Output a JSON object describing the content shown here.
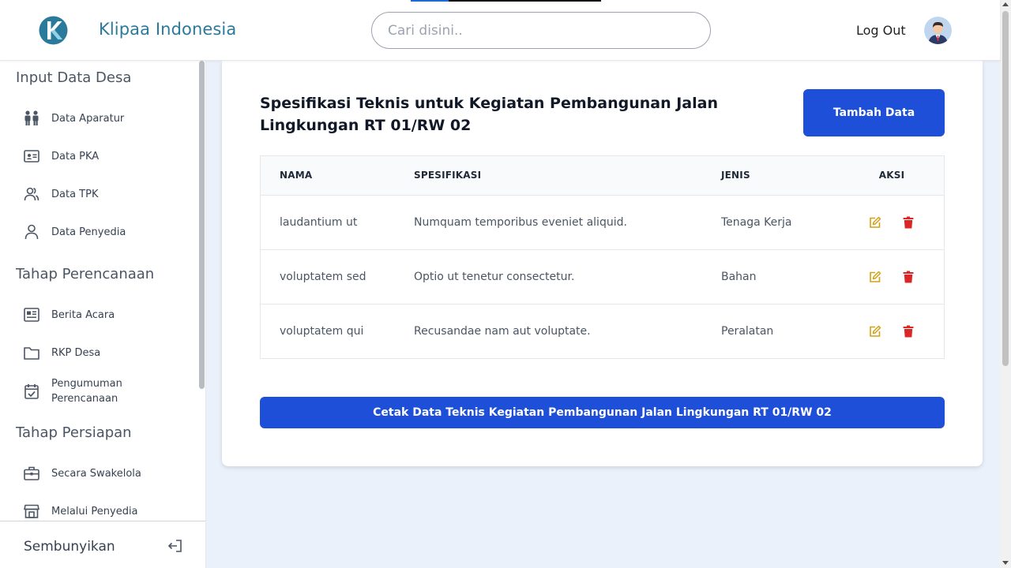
{
  "header": {
    "brand": "Klipaa Indonesia",
    "search_placeholder": "Cari disini..",
    "logout_label": "Log Out"
  },
  "sidebar": {
    "sections": [
      {
        "title": "Input Data Desa",
        "items": [
          {
            "label": "Data Aparatur",
            "icon": "people-icon"
          },
          {
            "label": "Data PKA",
            "icon": "id-card-icon"
          },
          {
            "label": "Data TPK",
            "icon": "users-icon"
          },
          {
            "label": "Data Penyedia",
            "icon": "user-icon"
          }
        ]
      },
      {
        "title": "Tahap Perencanaan",
        "items": [
          {
            "label": "Berita Acara",
            "icon": "newspaper-icon"
          },
          {
            "label": "RKP Desa",
            "icon": "folder-icon"
          },
          {
            "label": "Pengumuman Perencanaan",
            "icon": "calendar-check-icon"
          }
        ]
      },
      {
        "title": "Tahap Persiapan",
        "items": [
          {
            "label": "Secara Swakelola",
            "icon": "briefcase-icon"
          },
          {
            "label": "Melalui Penyedia",
            "icon": "store-icon"
          }
        ]
      }
    ],
    "footer_label": "Sembunyikan"
  },
  "main": {
    "title": "Spesifikasi Teknis untuk Kegiatan Pembangunan Jalan Lingkungan RT 01/RW 02",
    "add_button": "Tambah Data",
    "columns": [
      "NAMA",
      "SPESIFIKASI",
      "JENIS",
      "AKSI"
    ],
    "rows": [
      {
        "nama": "laudantium ut",
        "spesifikasi": "Numquam temporibus eveniet aliquid.",
        "jenis": "Tenaga Kerja"
      },
      {
        "nama": "voluptatem sed",
        "spesifikasi": "Optio ut tenetur consectetur.",
        "jenis": "Bahan"
      },
      {
        "nama": "voluptatem qui",
        "spesifikasi": "Recusandae nam aut voluptate.",
        "jenis": "Peralatan"
      }
    ],
    "print_button": "Cetak Data Teknis Kegiatan Pembangunan Jalan Lingkungan RT 01/RW 02"
  },
  "colors": {
    "primary": "#1e4fd8",
    "brand": "#2a7a9c",
    "edit": "#d4a017",
    "delete": "#dc2626"
  }
}
